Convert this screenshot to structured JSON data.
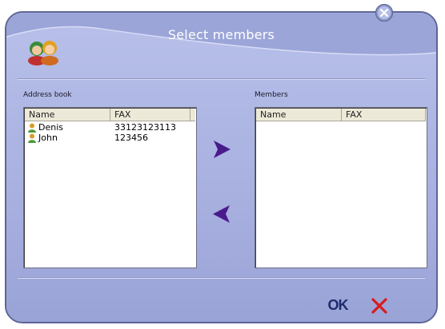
{
  "window": {
    "title": "Select members"
  },
  "address_book": {
    "label": "Address book",
    "columns": [
      "Name",
      "FAX"
    ],
    "rows": [
      {
        "name": "Denis",
        "fax": "33123123113"
      },
      {
        "name": "John",
        "fax": "123456"
      }
    ]
  },
  "members": {
    "label": "Members",
    "columns": [
      "Name",
      "FAX"
    ],
    "rows": []
  },
  "buttons": {
    "ok_label": "OK",
    "add_icon": "arrow-right-icon",
    "remove_icon": "arrow-left-icon",
    "cancel_icon": "close-x-icon",
    "close_icon": "close-icon"
  },
  "colors": {
    "dialog_background": "#aab3e0",
    "arrow": "#4a1a8c",
    "cancel": "#d81c1c",
    "ok": "#1e2c6e"
  }
}
